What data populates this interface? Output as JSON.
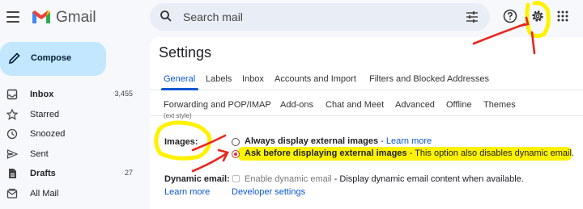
{
  "app": {
    "name": "Gmail"
  },
  "search": {
    "placeholder": "Search mail"
  },
  "sidebar": {
    "compose_label": "Compose",
    "items": [
      {
        "label": "Inbox",
        "count": "3,455",
        "bold": true
      },
      {
        "label": "Starred",
        "count": "",
        "bold": false
      },
      {
        "label": "Snoozed",
        "count": "",
        "bold": false
      },
      {
        "label": "Sent",
        "count": "",
        "bold": false
      },
      {
        "label": "Drafts",
        "count": "27",
        "bold": true
      },
      {
        "label": "All Mail",
        "count": "",
        "bold": false
      }
    ]
  },
  "settings": {
    "title": "Settings",
    "tabs_row1": [
      "General",
      "Labels",
      "Inbox",
      "Accounts and Import",
      "Filters and Blocked Addresses"
    ],
    "tabs_row2": [
      "Forwarding and POP/IMAP",
      "Add-ons",
      "Chat and Meet",
      "Advanced",
      "Offline",
      "Themes"
    ],
    "active_tab": "General",
    "cutoff_text": "(ext style)",
    "images": {
      "label": "Images:",
      "option1_text": "Always display external images",
      "option1_sep": " - ",
      "option1_link": "Learn more",
      "option2_text": "Ask before displaying external images",
      "option2_desc": " - This option also disables dynamic email.",
      "selected": "option2"
    },
    "dynamic_email": {
      "label": "Dynamic email:",
      "link": "Learn more",
      "checkbox_label": "Enable dynamic email",
      "desc": " - Display dynamic email content when available.",
      "dev_link": "Developer settings"
    }
  },
  "colors": {
    "accent": "#0b57d0",
    "compose_bg": "#c2e7ff",
    "annotation": "#e8271f",
    "highlight": "#fff200"
  }
}
